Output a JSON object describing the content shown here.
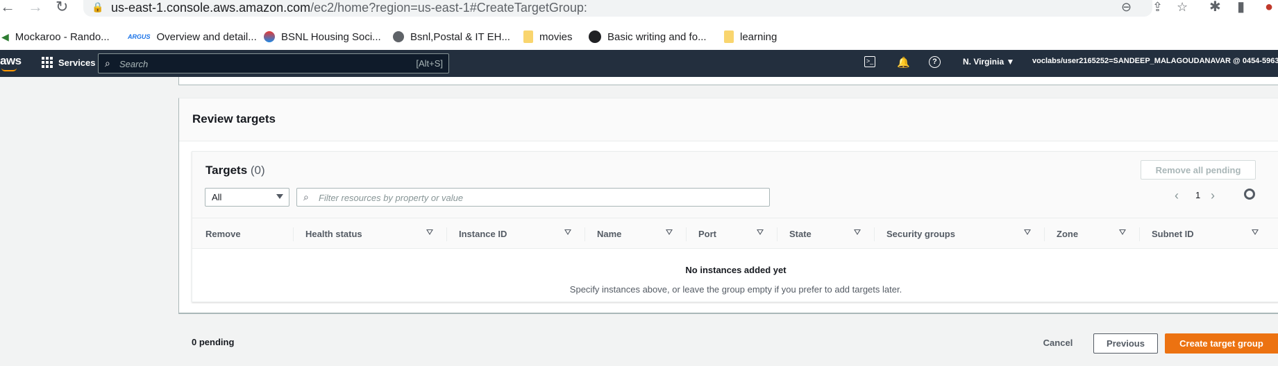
{
  "browser": {
    "url_host": "us-east-1.console.aws.amazon.com",
    "url_path": "/ec2/home?region=us-east-1#CreateTargetGroup:",
    "bookmarks": [
      {
        "label": "Mockaroo - Rando...",
        "icon": "kangaroo-icon"
      },
      {
        "label": "Overview and detail...",
        "icon": "site-logo-icon"
      },
      {
        "label": "BSNL Housing Soci...",
        "icon": "bsnl-icon"
      },
      {
        "label": "Bsnl,Postal & IT EH...",
        "icon": "globe-icon"
      },
      {
        "label": "movies",
        "icon": "folder-icon"
      },
      {
        "label": "Basic writing and fo...",
        "icon": "github-icon"
      },
      {
        "label": "learning",
        "icon": "folder-icon"
      }
    ]
  },
  "aws_header": {
    "logo": "aws",
    "services_label": "Services",
    "search_placeholder": "Search",
    "search_shortcut": "[Alt+S]",
    "region": "N. Virginia ▼",
    "account": "voclabs/user2165252=SANDEEP_MALAGOUDANAVAR @ 0454-5963"
  },
  "review": {
    "title": "Review targets",
    "targets_label": "Targets",
    "targets_count": "(0)",
    "remove_all_label": "Remove all pending",
    "filter_select": "All",
    "filter_placeholder": "Filter resources by property or value",
    "page_number": "1",
    "columns": [
      "Remove",
      "Health status",
      "Instance ID",
      "Name",
      "Port",
      "State",
      "Security groups",
      "Zone",
      "Subnet ID"
    ],
    "empty_title": "No instances added yet",
    "empty_desc": "Specify instances above, or leave the group empty if you prefer to add targets later."
  },
  "footer": {
    "pending": "0 pending",
    "cancel": "Cancel",
    "previous": "Previous",
    "create": "Create target group"
  },
  "colors": {
    "aws_nav": "#232f3e",
    "primary": "#ec7211",
    "border": "#aab7b8"
  }
}
